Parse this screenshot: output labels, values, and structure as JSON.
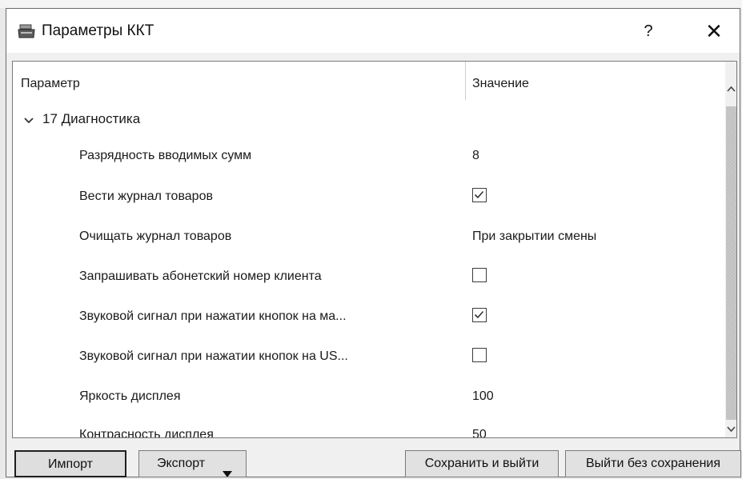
{
  "window": {
    "title": "Параметры ККТ",
    "help_label": "?",
    "close_label": "✕"
  },
  "table": {
    "columns": [
      "Параметр",
      "Значение"
    ],
    "group": {
      "label": "17 Диагностика",
      "expanded": true
    },
    "rows": [
      {
        "label": "Разрядность вводимых сумм",
        "type": "text",
        "value": "8"
      },
      {
        "label": "Вести журнал товаров",
        "type": "checkbox",
        "checked": true
      },
      {
        "label": "Очищать журнал товаров",
        "type": "text",
        "value": "При закрытии смены"
      },
      {
        "label": "Запрашивать абонетский номер клиента",
        "type": "checkbox",
        "checked": false
      },
      {
        "label": "Звуковой сигнал при нажатии кнопок на ма...",
        "type": "checkbox",
        "checked": true
      },
      {
        "label": "Звуковой сигнал при нажатии кнопок на US...",
        "type": "checkbox",
        "checked": false
      },
      {
        "label": "Яркость дисплея",
        "type": "text",
        "value": "100"
      },
      {
        "label": "Контрасность дисплея",
        "type": "text",
        "value": "50"
      }
    ]
  },
  "footer": {
    "import_label": "Импорт",
    "export_label": "Экспорт",
    "save_exit_label": "Сохранить и выйти",
    "exit_no_save_label": "Выйти без сохранения"
  },
  "icons": {
    "app": "cash-register-icon",
    "group_toggle": "chevron-down-icon",
    "export_menu": "caret-down-icon",
    "scroll_up": "scroll-up-arrow-icon",
    "scroll_down": "scroll-down-arrow-icon"
  }
}
